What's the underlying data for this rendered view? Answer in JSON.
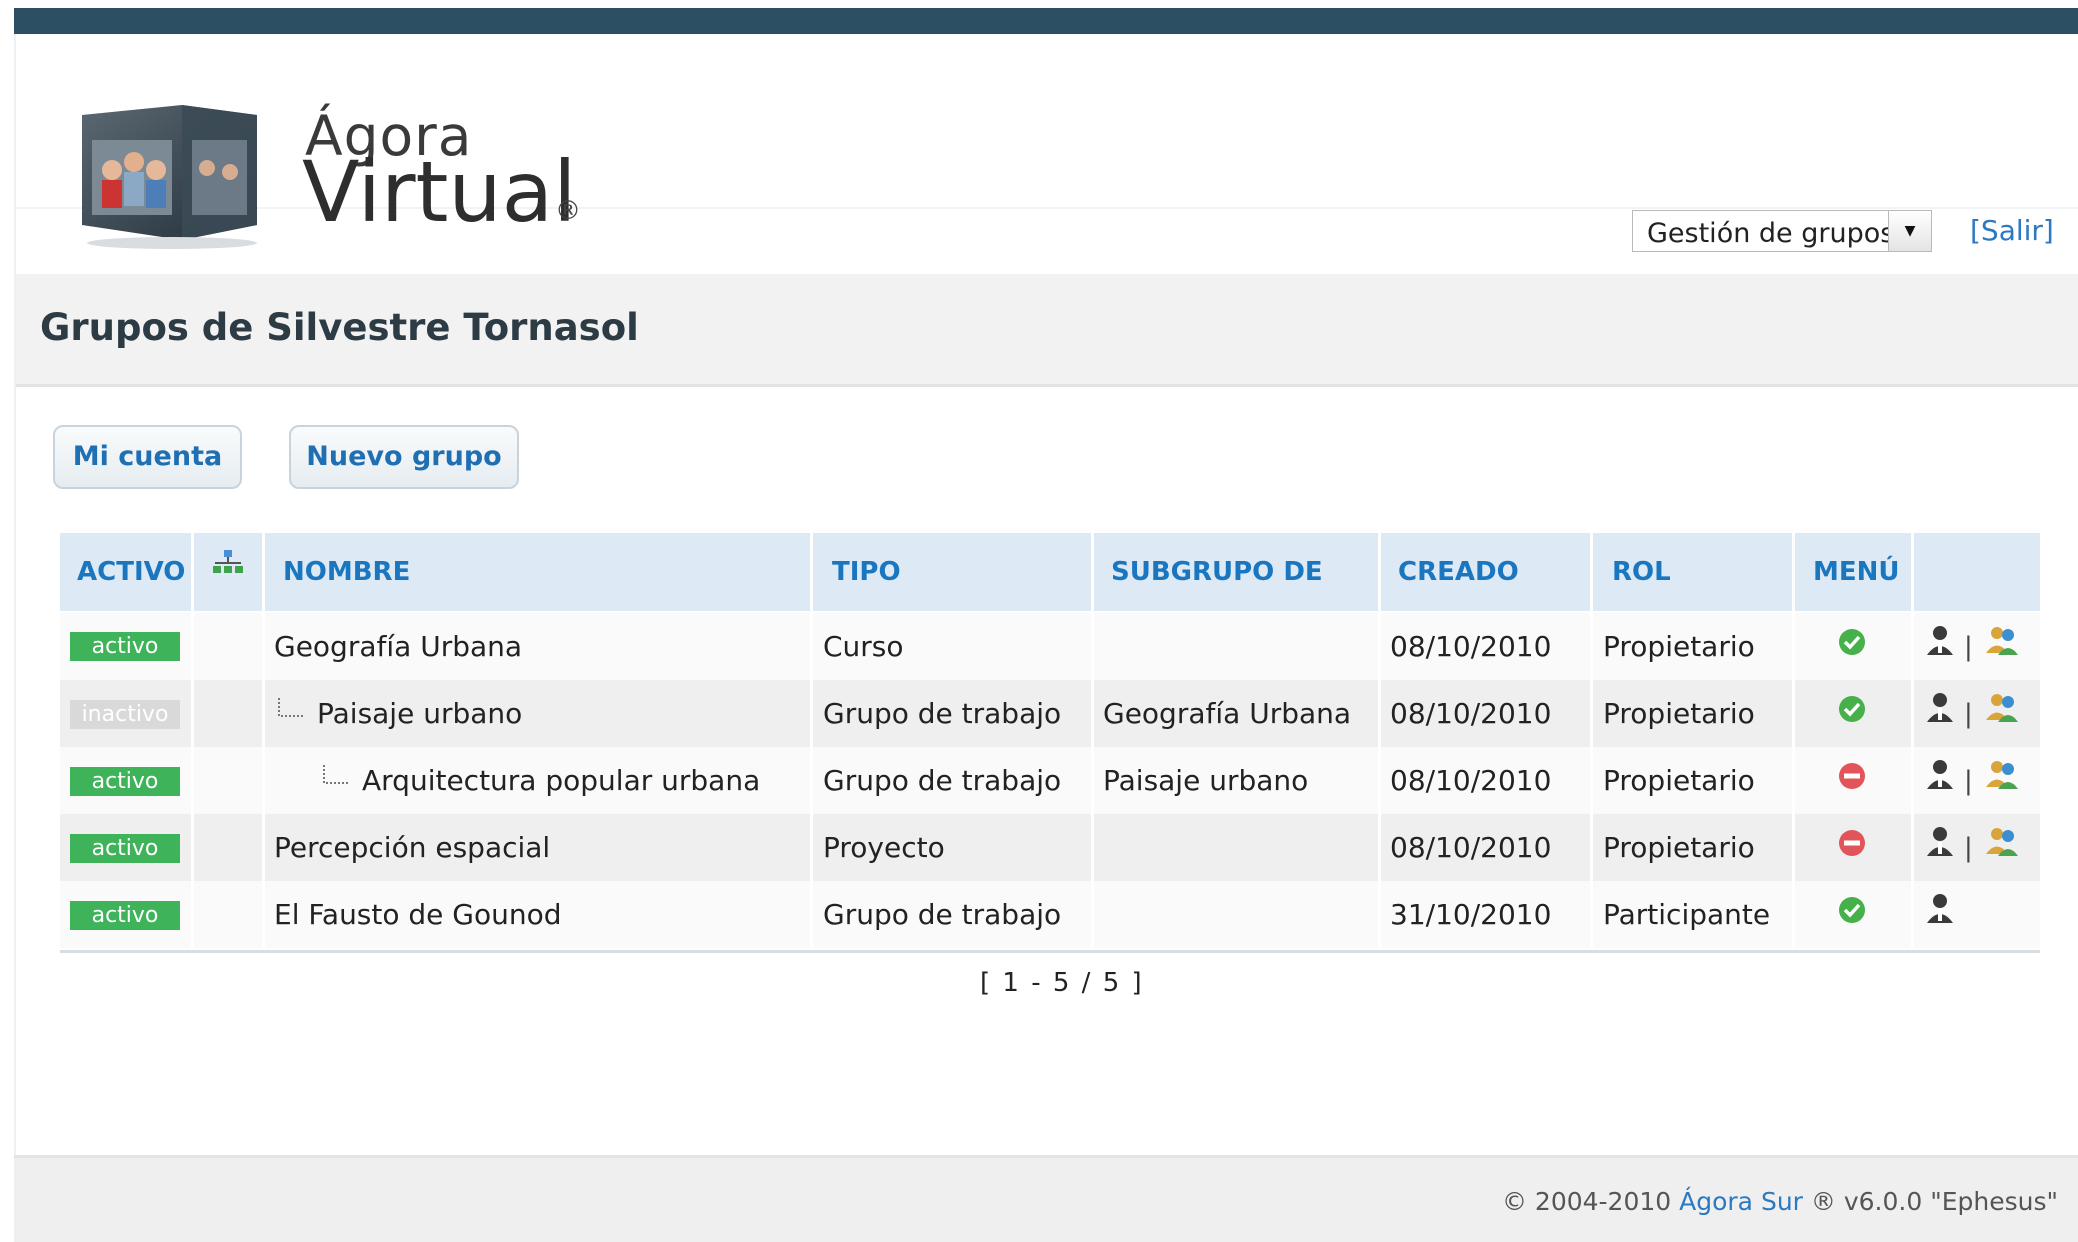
{
  "header": {
    "logo_line1": "Ágora",
    "logo_line2": "Virtual",
    "logo_reg": "®",
    "select_value": "Gestión de grupos",
    "logout_link": "[Salir]"
  },
  "page": {
    "title": "Grupos de Silvestre Tornasol"
  },
  "toolbar": {
    "my_account": "Mi cuenta",
    "new_group": "Nuevo grupo"
  },
  "table": {
    "columns": {
      "activo": "ACTIVO",
      "nombre": "NOMBRE",
      "tipo": "TIPO",
      "subgrupo": "SUBGRUPO DE",
      "creado": "CREADO",
      "rol": "ROL",
      "menu": "MENÚ"
    },
    "rows": [
      {
        "status": "activo",
        "name": "Geografía Urbana",
        "type": "Curso",
        "parent": "",
        "created": "08/10/2010",
        "role": "Propietario",
        "menu": "enabled"
      },
      {
        "status": "inactivo",
        "name": "Paisaje urbano",
        "type": "Grupo de trabajo",
        "parent": "Geografía Urbana",
        "created": "08/10/2010",
        "role": "Propietario",
        "menu": "enabled"
      },
      {
        "status": "activo",
        "name": "Arquitectura popular urbana",
        "type": "Grupo de trabajo",
        "parent": "Paisaje urbano",
        "created": "08/10/2010",
        "role": "Propietario",
        "menu": "disabled"
      },
      {
        "status": "activo",
        "name": "Percepción espacial",
        "type": "Proyecto",
        "parent": "",
        "created": "08/10/2010",
        "role": "Propietario",
        "menu": "disabled"
      },
      {
        "status": "activo",
        "name": "El Fausto de Gounod",
        "type": "Grupo de trabajo",
        "parent": "",
        "created": "31/10/2010",
        "role": "Participante",
        "menu": "enabled"
      }
    ],
    "pager": "[ 1 - 5 / 5 ]"
  },
  "footer": {
    "copyright": "© 2004-2010",
    "brand": "Ágora Sur",
    "version": "® v6.0.0 \"Ephesus\""
  },
  "colors": {
    "topbar": "#2c4f63",
    "accent": "#1b76c0",
    "active_badge": "#3fb35a",
    "inactive_badge": "#d9d9d9"
  }
}
